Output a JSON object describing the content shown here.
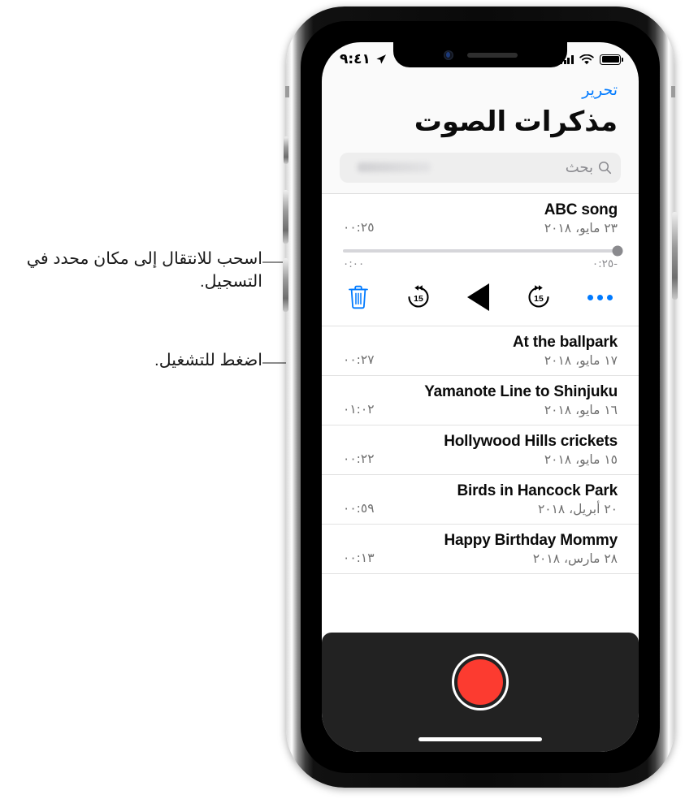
{
  "annotations": [
    {
      "id": "scrub-callout",
      "text": "اسحب للانتقال إلى مكان محدد في التسجيل."
    },
    {
      "id": "play-callout",
      "text": "اضغط للتشغيل."
    }
  ],
  "status_bar": {
    "battery_icon": "battery-icon",
    "wifi_icon": "wifi-icon",
    "signal_icon": "cellular-signal-icon",
    "location_icon": "location-arrow-icon",
    "time": "٩:٤١"
  },
  "nav": {
    "edit_label": "تحرير",
    "title": "مذكرات الصوت"
  },
  "search": {
    "placeholder": "بحث",
    "value": "",
    "icon": "search-icon"
  },
  "colors": {
    "accent_blue": "#007AFF",
    "record_red": "#FC3B30",
    "recordbar_bg": "#222222",
    "track_gray": "#D6D6DA"
  },
  "selected_memo": {
    "title": "ABC song",
    "date": "٢٣ مايو، ٢٠١٨",
    "duration": "٠٠:٢٥",
    "scrubber": {
      "elapsed": "٠:٠٠",
      "remaining": "-٠:٢٥",
      "progress_percent": 0
    },
    "controls": {
      "delete_label": "delete",
      "skip_back_label": "15",
      "play_label": "play",
      "skip_forward_label": "15",
      "more_label": "•••"
    }
  },
  "memos": [
    {
      "title": "At the ballpark",
      "date": "١٧ مايو، ٢٠١٨",
      "duration": "٠٠:٢٧"
    },
    {
      "title": "Yamanote Line to Shinjuku",
      "date": "١٦ مايو، ٢٠١٨",
      "duration": "٠١:٠٢"
    },
    {
      "title": "Hollywood Hills crickets",
      "date": "١٥ مايو، ٢٠١٨",
      "duration": "٠٠:٢٢"
    },
    {
      "title": "Birds in Hancock Park",
      "date": "٢٠ أبريل، ٢٠١٨",
      "duration": "٠٠:٥٩"
    },
    {
      "title": "Happy Birthday Mommy",
      "date": "٢٨ مارس، ٢٠١٨",
      "duration": "٠٠:١٣"
    }
  ],
  "record_bar": {
    "record_button_label": "record"
  }
}
